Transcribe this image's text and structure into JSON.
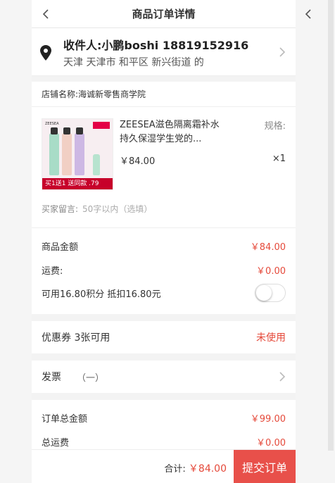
{
  "header": {
    "title": "商品订单详情"
  },
  "address": {
    "receiver": "收件人:小鹏boshi 18819152916",
    "detail": "天津 天津市 和平区 新兴街道 的"
  },
  "shop": {
    "label": "店铺名称:",
    "name": "海诚新零售商学院"
  },
  "product": {
    "name": "ZEESEA滋色隔离霜补水持久保湿学生党的...",
    "spec_label": "规格:",
    "price": "￥84.00",
    "qty": "×1",
    "image_brand": "ZEESEA",
    "image_promo": "买1送1 送同款 .79"
  },
  "message": {
    "label": "买家留言:",
    "placeholder": "50字以内（选填）"
  },
  "amounts": {
    "goods_label": "商品金额",
    "goods_value": "￥84.00",
    "freight_label": "运费:",
    "freight_value": "￥0.00",
    "points_label": "可用16.80积分 抵扣16.80元",
    "points_enabled": false
  },
  "coupon": {
    "label": "优惠券 3张可用",
    "status": "未使用"
  },
  "invoice": {
    "label": "发票",
    "value": "（一）"
  },
  "totals": {
    "order_total_label": "订单总金额",
    "order_total_value": "￥99.00",
    "total_freight_label": "总运费",
    "total_freight_value": "￥0.00"
  },
  "footer": {
    "sum_label": "合计:",
    "sum_value": "￥84.00",
    "submit_label": "提交订单"
  },
  "colors": {
    "accent": "#e5493a",
    "submit_bg": "#e8504a"
  }
}
